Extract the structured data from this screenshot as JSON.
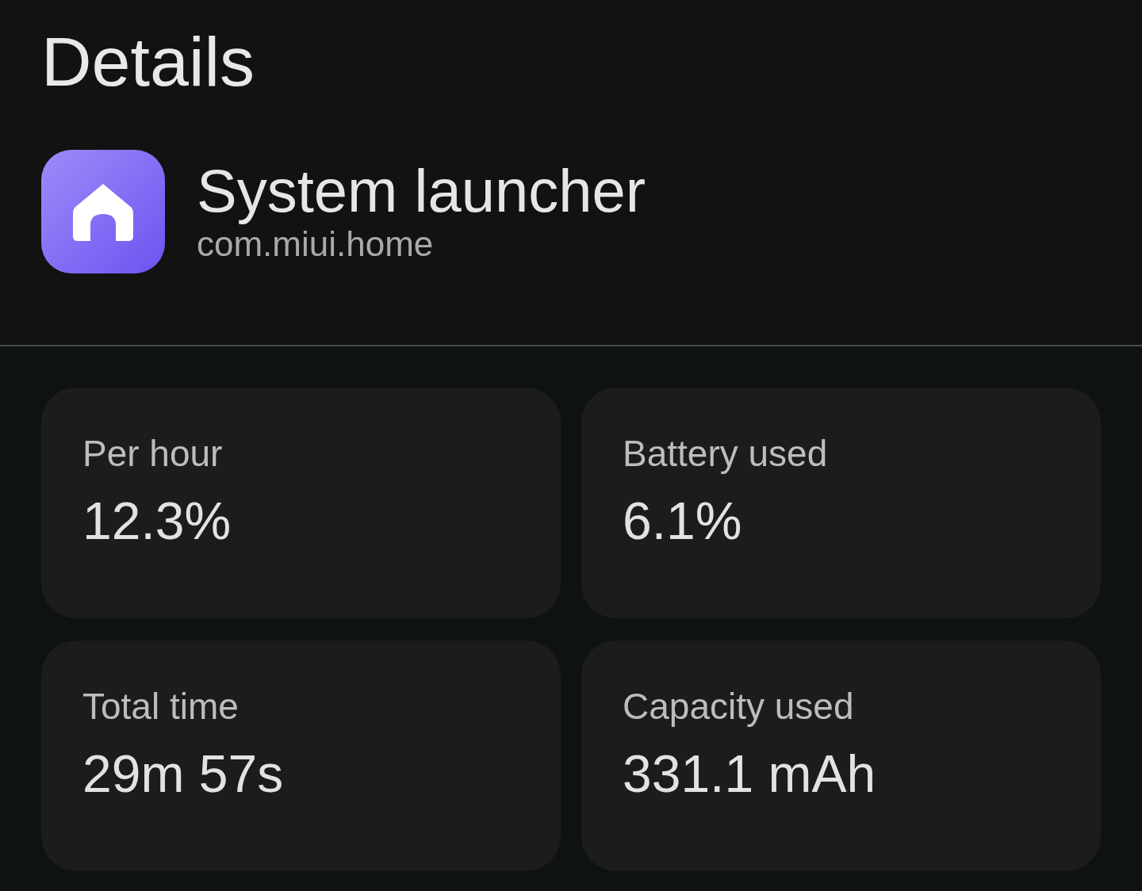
{
  "header": {
    "title": "Details"
  },
  "app": {
    "name": "System launcher",
    "package": "com.miui.home"
  },
  "stats": [
    {
      "label": "Per hour",
      "value": "12.3%"
    },
    {
      "label": "Battery used",
      "value": "6.1%"
    },
    {
      "label": "Total time",
      "value": "29m 57s"
    },
    {
      "label": "Capacity used",
      "value": "331.1 mAh"
    }
  ]
}
